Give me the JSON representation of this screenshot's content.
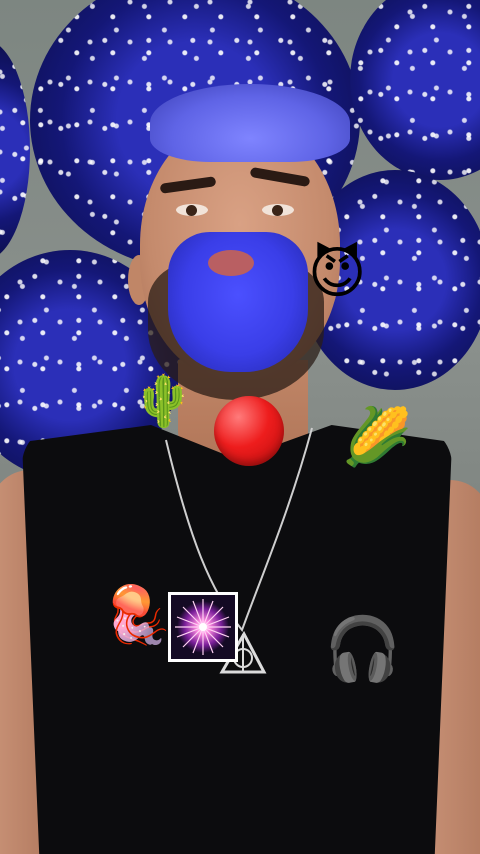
{
  "screen": {
    "title": "",
    "record_button": {
      "icon": "record-circle-red",
      "color": "#e81c1c"
    },
    "gallery_thumbnail": {
      "icon": "firework-sparkle",
      "border_color": "#ffffff"
    }
  },
  "stickers": [
    {
      "name": "smiling-devil",
      "glyph": "😈"
    },
    {
      "name": "cactus",
      "glyph": "🌵"
    },
    {
      "name": "corn",
      "glyph": "🌽"
    },
    {
      "name": "jellyfish",
      "glyph": "🪼"
    },
    {
      "name": "headphones",
      "glyph": "🎧"
    }
  ],
  "colors": {
    "hair_beard_tint": "#4b50ff",
    "flowers": "#1d21a5",
    "shirt": "#0c0c0e"
  }
}
